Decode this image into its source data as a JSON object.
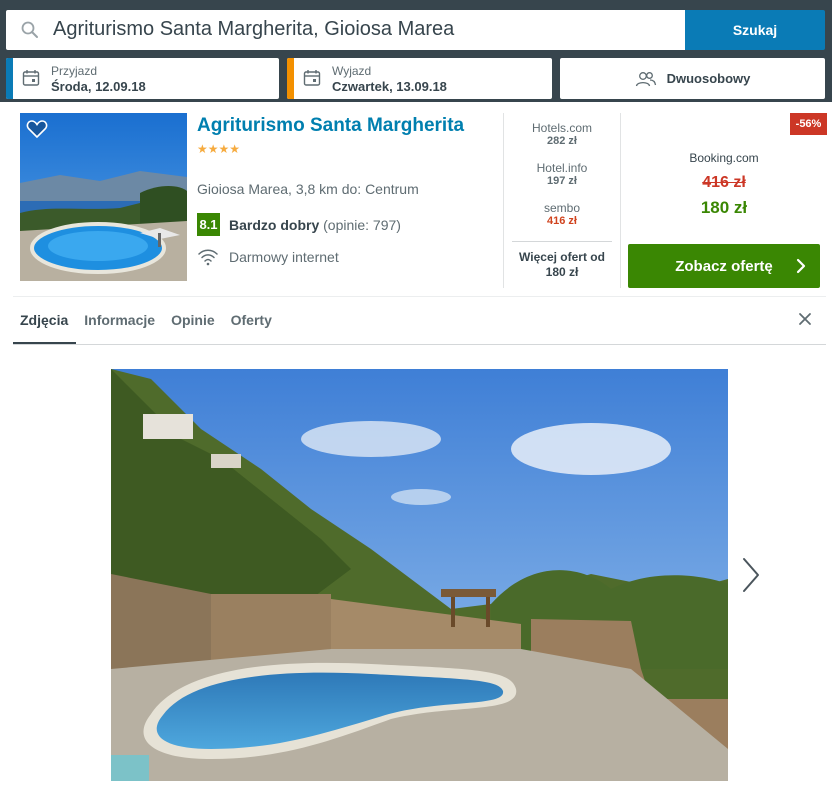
{
  "search": {
    "query": "Agriturismo Santa Margherita, Gioiosa Marea",
    "button_label": "Szukaj"
  },
  "checkin": {
    "label": "Przyjazd",
    "value": "Środa, 12.09.18",
    "accent": "#0a7bb6"
  },
  "checkout": {
    "label": "Wyjazd",
    "value": "Czwartek, 13.09.18",
    "accent": "#f39000"
  },
  "room": {
    "label": "Dwuosobowy"
  },
  "hotel": {
    "name": "Agriturismo Santa Margherita",
    "stars": "★★★★",
    "location": "Gioiosa Marea, 3,8 km do: Centrum",
    "rating_score": "8.1",
    "rating_label": "Bardzo dobry",
    "rating_reviews": "(opinie: 797)",
    "amenity": "Darmowy internet"
  },
  "offers": [
    {
      "site": "Hotels.com",
      "price": "282 zł"
    },
    {
      "site": "Hotel.info",
      "price": "197 zł"
    },
    {
      "site": "sembo",
      "price": "416 zł"
    }
  ],
  "more_offers": {
    "label": "Więcej ofert od",
    "price": "180 zł"
  },
  "best_deal": {
    "discount": "-56%",
    "site": "Booking.com",
    "old_price": "416 zł",
    "price": "180 zł",
    "button_label": "Zobacz ofertę"
  },
  "tabs": [
    {
      "label": "Zdjęcia",
      "active": true
    },
    {
      "label": "Informacje",
      "active": false
    },
    {
      "label": "Opinie",
      "active": false
    },
    {
      "label": "Oferty",
      "active": false
    }
  ],
  "colors": {
    "header_bg": "#37454d",
    "primary_blue": "#0a7bb6",
    "deal_green": "#3a8703",
    "discount_red": "#cc3726",
    "star_orange": "#f6ab3f"
  },
  "icons": [
    "search-icon",
    "calendar-icon",
    "users-icon",
    "heart-icon",
    "wifi-icon",
    "chevron-right-icon",
    "close-icon"
  ]
}
